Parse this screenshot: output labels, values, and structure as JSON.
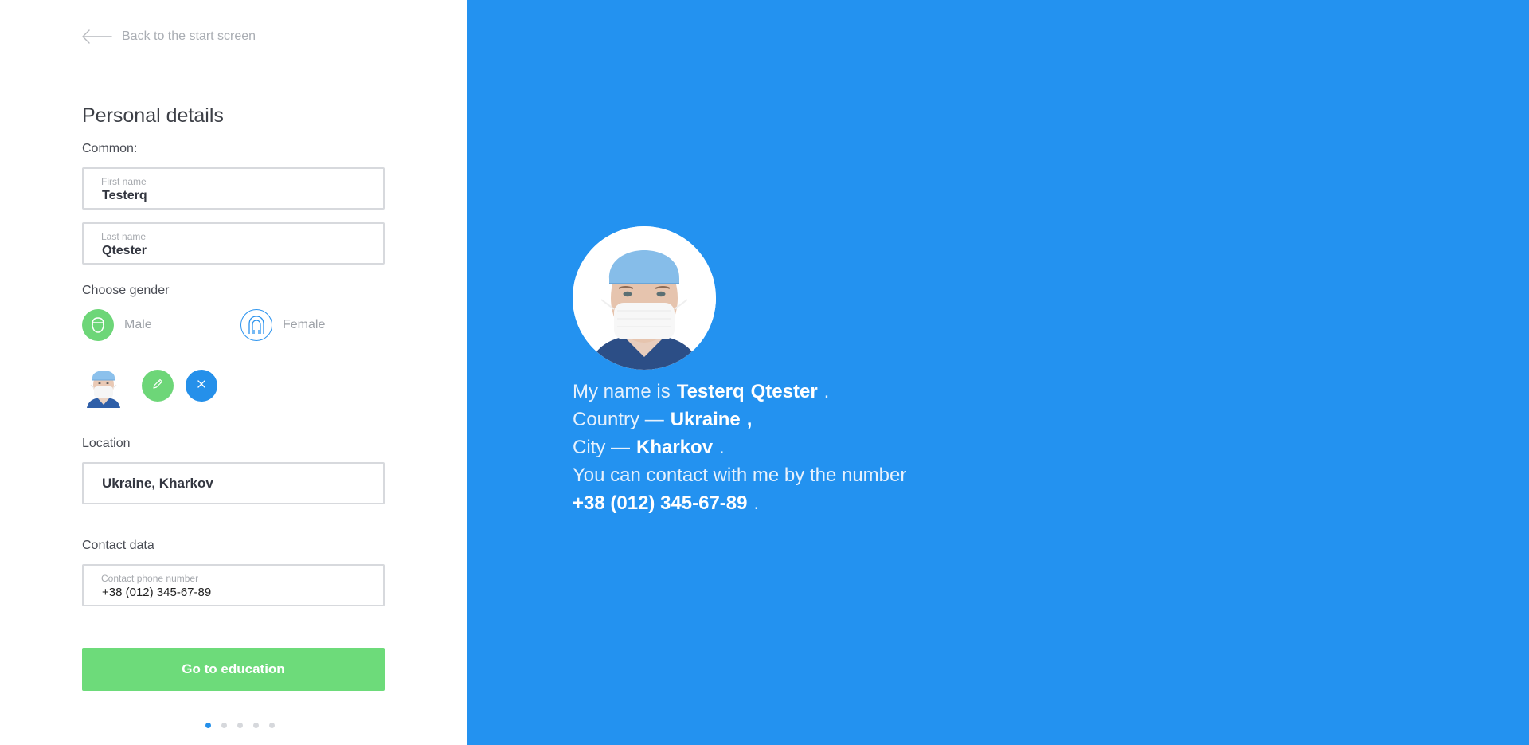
{
  "back": {
    "label": "Back to the start screen"
  },
  "title": "Personal details",
  "common_label": "Common:",
  "first_name": {
    "label": "First name",
    "value": "Testerq"
  },
  "last_name": {
    "label": "Last name",
    "value": "Qtester"
  },
  "gender": {
    "label": "Choose gender",
    "male": "Male",
    "female": "Female",
    "selected": "Male"
  },
  "location": {
    "label": "Location",
    "value": "Ukraine, Kharkov"
  },
  "contact": {
    "label": "Contact data",
    "phone_label": "Contact phone number",
    "phone_value": "+38 (012) 345-67-89"
  },
  "primary_button": "Go to education",
  "pager": {
    "count": 5,
    "active": 1
  },
  "bio": {
    "name_prefix": "My name is",
    "first_name": "Testerq",
    "last_name": "Qtester",
    "name_suffix": ".",
    "country_prefix": "Country —",
    "country": "Ukraine",
    "country_suffix": ",",
    "city_prefix": "City —",
    "city": "Kharkov",
    "city_suffix": ".",
    "contact_text": "You can contact with me by the number",
    "phone": "+38 (012) 345-67-89",
    "phone_suffix": "."
  },
  "colors": {
    "accent_blue": "#2392f0",
    "accent_green": "#6dd678",
    "button_green": "#6ddb7a"
  },
  "icons": [
    "arrow-left-icon",
    "male-head-icon",
    "female-head-icon",
    "pencil-icon",
    "close-icon"
  ]
}
